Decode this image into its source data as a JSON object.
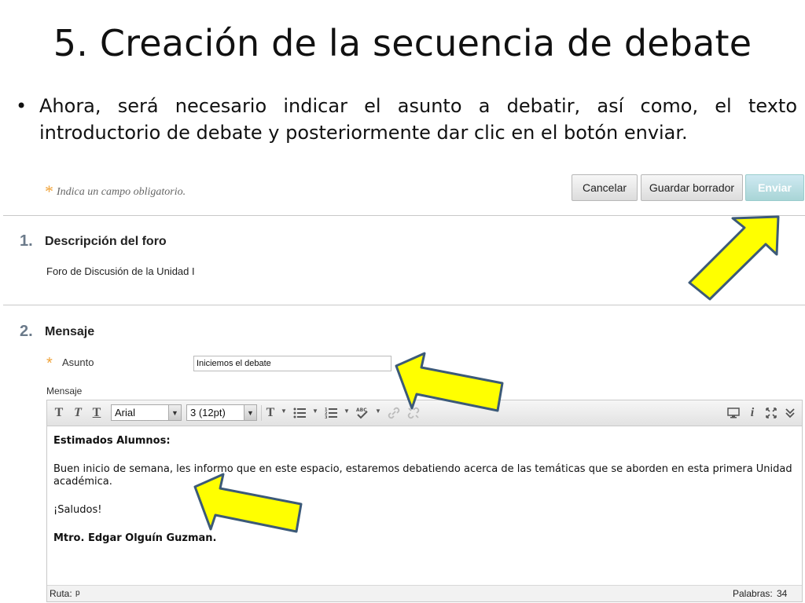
{
  "slide": {
    "title": "5. Creación de la secuencia de debate",
    "bullet": "•",
    "bullet_text": "Ahora, será necesario indicar el asunto a debatir, así como, el texto introductorio de debate y posteriormente dar clic en el botón enviar."
  },
  "form": {
    "required_star": "*",
    "required_note": "Indica un campo obligatorio.",
    "buttons": {
      "cancel": "Cancelar",
      "save_draft": "Guardar borrador",
      "send": "Enviar"
    },
    "section1": {
      "number": "1.",
      "title": "Descripción del foro",
      "description": "Foro de Discusión de la Unidad I"
    },
    "section2": {
      "number": "2.",
      "title": "Mensaje",
      "subject_label": "Asunto",
      "subject_value": "Iniciemos el debate",
      "message_label": "Mensaje"
    }
  },
  "editor": {
    "toolbar": {
      "font_family": "Arial",
      "font_size": "3 (12pt)",
      "icons": [
        "bold-icon",
        "italic-icon",
        "underline-icon",
        "text-color-icon",
        "bullet-list-icon",
        "numbered-list-icon",
        "spellcheck-icon",
        "link-icon",
        "unlink-icon",
        "preview-icon",
        "info-icon",
        "fullscreen-icon",
        "collapse-icon"
      ]
    },
    "content": {
      "greeting": "Estimados Alumnos:",
      "body": "Buen inicio de semana, les informo que en este espacio, estaremos debatiendo acerca de las temáticas que se aborden en esta primera Unidad académica.",
      "closing": "¡Saludos!",
      "signature": "Mtro. Edgar Olguín Guzman."
    },
    "status": {
      "path_label": "Ruta:",
      "path_value": "p",
      "word_count_label": "Palabras:",
      "word_count": "34"
    }
  },
  "colors": {
    "arrow_fill": "#ffff00",
    "arrow_stroke": "#3c5a78",
    "required_star": "#f0a33a",
    "send_button": "#a8d5d6"
  }
}
